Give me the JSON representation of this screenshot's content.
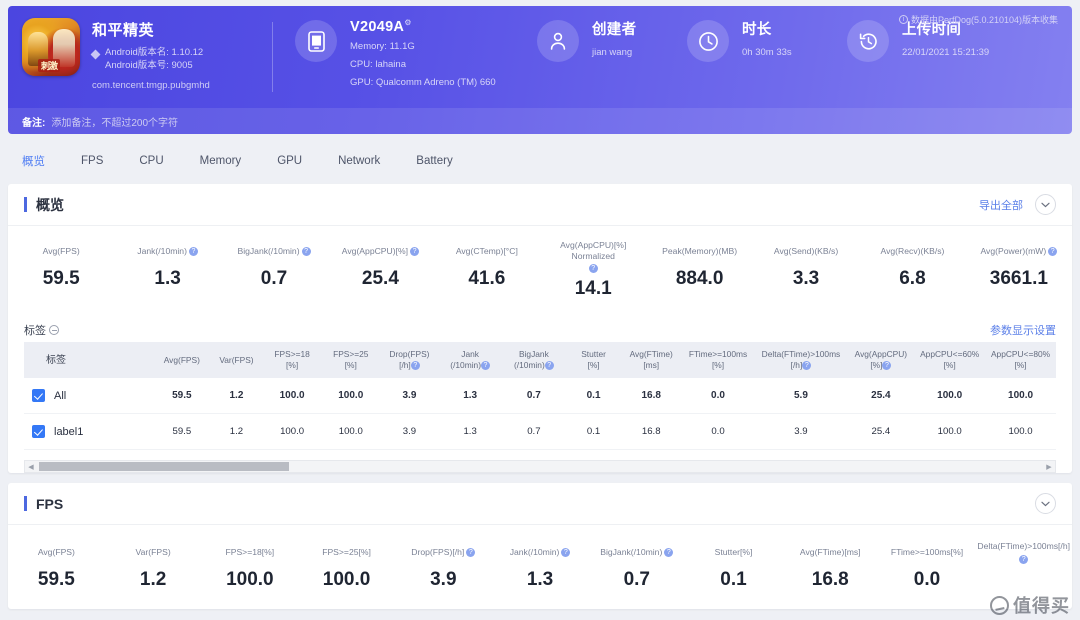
{
  "header": {
    "app": {
      "name": "和平精英",
      "icon_badge": "刺激",
      "version_name_line": "Android版本名: 1.10.12",
      "version_code_line": "Android版本号: 9005",
      "package": "com.tencent.tmgp.pubgmhd"
    },
    "device": {
      "title": "V2049A",
      "title_sup": "⚙",
      "memory": "Memory: 11.1G",
      "cpu": "CPU: lahaina",
      "gpu": "GPU: Qualcomm Adreno (TM) 660"
    },
    "creator": {
      "title": "创建者",
      "value": "jian wang"
    },
    "duration": {
      "title": "时长",
      "value": "0h 30m 33s"
    },
    "upload": {
      "title": "上传时间",
      "value": "22/01/2021 15:21:39"
    },
    "collector_note": "数据由PerfDog(5.0.210104)版本收集",
    "remark": {
      "label": "备注:",
      "placeholder": "添加备注，不超过200个字符"
    }
  },
  "tabs": [
    {
      "label": "概览",
      "active": true
    },
    {
      "label": "FPS",
      "active": false
    },
    {
      "label": "CPU",
      "active": false
    },
    {
      "label": "Memory",
      "active": false
    },
    {
      "label": "GPU",
      "active": false
    },
    {
      "label": "Network",
      "active": false
    },
    {
      "label": "Battery",
      "active": false
    }
  ],
  "overview": {
    "title": "概览",
    "export_all": "导出全部",
    "collapse_icon": "chevron-down",
    "metrics": [
      {
        "label": "Avg(FPS)",
        "help": false,
        "value": "59.5"
      },
      {
        "label": "Jank(/10min)",
        "help": true,
        "value": "1.3"
      },
      {
        "label": "BigJank(/10min)",
        "help": true,
        "value": "0.7"
      },
      {
        "label": "Avg(AppCPU)[%]",
        "help": true,
        "value": "25.4"
      },
      {
        "label": "Avg(CTemp)[°C]",
        "help": false,
        "value": "41.6"
      },
      {
        "label": "Avg(AppCPU)[%] Normalized",
        "help": true,
        "value": "14.1"
      },
      {
        "label": "Peak(Memory)(MB)",
        "help": false,
        "value": "884.0"
      },
      {
        "label": "Avg(Send)(KB/s)",
        "help": false,
        "value": "3.3"
      },
      {
        "label": "Avg(Recv)(KB/s)",
        "help": false,
        "value": "6.8"
      },
      {
        "label": "Avg(Power)(mW)",
        "help": true,
        "value": "3661.1"
      }
    ],
    "table": {
      "section_label": "标签",
      "settings_link": "参数显示设置",
      "columns": [
        {
          "l1": "标签",
          "l2": "",
          "help": false
        },
        {
          "l1": "Avg(FPS)",
          "l2": "",
          "help": false
        },
        {
          "l1": "Var(FPS)",
          "l2": "",
          "help": false
        },
        {
          "l1": "FPS>=18",
          "l2": "[%]",
          "help": false
        },
        {
          "l1": "FPS>=25",
          "l2": "[%]",
          "help": false
        },
        {
          "l1": "Drop(FPS)",
          "l2": "[/h]",
          "help": true
        },
        {
          "l1": "Jank",
          "l2": "(/10min)",
          "help": true
        },
        {
          "l1": "BigJank",
          "l2": "(/10min)",
          "help": true
        },
        {
          "l1": "Stutter",
          "l2": "[%]",
          "help": false
        },
        {
          "l1": "Avg(FTime)",
          "l2": "[ms]",
          "help": false
        },
        {
          "l1": "FTime>=100ms",
          "l2": "[%]",
          "help": false
        },
        {
          "l1": "Delta(FTime)>100ms",
          "l2": "[/h]",
          "help": true
        },
        {
          "l1": "Avg(AppCPU)",
          "l2": "[%]",
          "help": true
        },
        {
          "l1": "AppCPU<=60%",
          "l2": "[%]",
          "help": false
        },
        {
          "l1": "AppCPU<=80%",
          "l2": "[%]",
          "help": false
        }
      ],
      "rows": [
        {
          "checked": true,
          "label": "All",
          "cells": [
            "59.5",
            "1.2",
            "100.0",
            "100.0",
            "3.9",
            "1.3",
            "0.7",
            "0.1",
            "16.8",
            "0.0",
            "5.9",
            "25.4",
            "100.0",
            "100.0"
          ]
        },
        {
          "checked": true,
          "label": "label1",
          "cells": [
            "59.5",
            "1.2",
            "100.0",
            "100.0",
            "3.9",
            "1.3",
            "0.7",
            "0.1",
            "16.8",
            "0.0",
            "3.9",
            "25.4",
            "100.0",
            "100.0"
          ]
        }
      ]
    }
  },
  "fps": {
    "title": "FPS",
    "collapse_icon": "chevron-down",
    "metrics": [
      {
        "label": "Avg(FPS)",
        "help": false,
        "value": "59.5"
      },
      {
        "label": "Var(FPS)",
        "help": false,
        "value": "1.2"
      },
      {
        "label": "FPS>=18[%]",
        "help": false,
        "value": "100.0"
      },
      {
        "label": "FPS>=25[%]",
        "help": false,
        "value": "100.0"
      },
      {
        "label": "Drop(FPS)[/h]",
        "help": true,
        "value": "3.9"
      },
      {
        "label": "Jank(/10min)",
        "help": true,
        "value": "1.3"
      },
      {
        "label": "BigJank(/10min)",
        "help": true,
        "value": "0.7"
      },
      {
        "label": "Stutter[%]",
        "help": false,
        "value": "0.1"
      },
      {
        "label": "Avg(FTime)[ms]",
        "help": false,
        "value": "16.8"
      },
      {
        "label": "FTime>=100ms[%]",
        "help": false,
        "value": "0.0"
      },
      {
        "label": "Delta(FTime)>100ms[/h]",
        "help": true,
        "value": ""
      }
    ]
  },
  "watermark": {
    "text": "值得买"
  }
}
